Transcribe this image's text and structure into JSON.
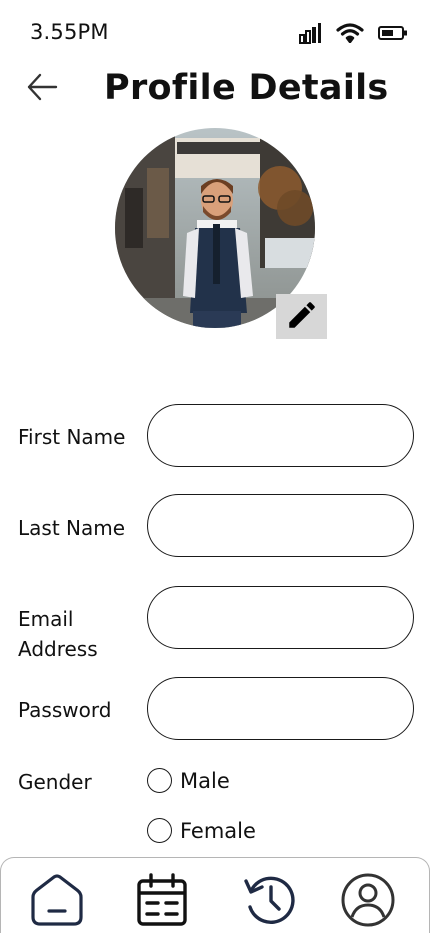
{
  "status_bar": {
    "time": "3.55PM",
    "icons": [
      "signal-icon",
      "wifi-icon",
      "battery-icon"
    ]
  },
  "header": {
    "back_icon": "arrow-left-icon",
    "title": "Profile Details"
  },
  "profile": {
    "avatar": "profile-photo",
    "edit_icon": "pencil-icon",
    "edit_button_color": "#d7d7d7"
  },
  "form": {
    "first_name": {
      "label": "First Name",
      "value": "",
      "placeholder": ""
    },
    "last_name": {
      "label": "Last Name",
      "value": "",
      "placeholder": ""
    },
    "email_line1": "Email",
    "email_line2": "Address",
    "email": {
      "value": "",
      "placeholder": ""
    },
    "password": {
      "label": "Password",
      "value": "",
      "placeholder": ""
    },
    "gender": {
      "label": "Gender",
      "options": [
        "Male",
        "Female"
      ],
      "selected": ""
    }
  },
  "bottom_nav": {
    "items": [
      "home-icon",
      "calendar-icon",
      "history-icon",
      "profile-icon"
    ],
    "home_color": "#1f2a44",
    "history_color": "#1f2a44"
  }
}
